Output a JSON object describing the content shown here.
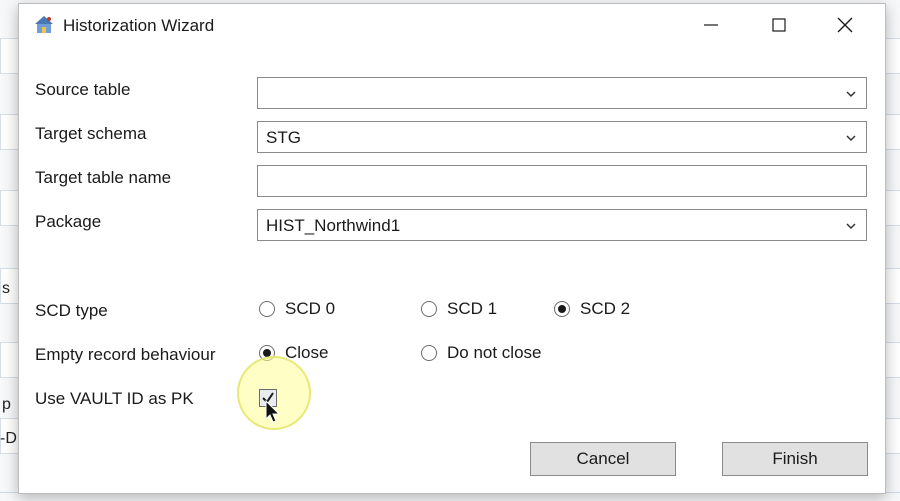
{
  "window": {
    "title": "Historization Wizard",
    "icon": "wizard-icon"
  },
  "form": {
    "source_table_label": "Source table",
    "source_table_value": "",
    "target_schema_label": "Target schema",
    "target_schema_value": "STG",
    "target_table_label": "Target table name",
    "target_table_value": "",
    "package_label": "Package",
    "package_value": "HIST_Northwind1",
    "scd_type_label": "SCD type",
    "scd_options": [
      "SCD 0",
      "SCD 1",
      "SCD 2"
    ],
    "scd_selected": "SCD 2",
    "empty_record_label": "Empty record behaviour",
    "empty_record_options": [
      "Close",
      "Do not close"
    ],
    "empty_record_selected": "Close",
    "vault_id_label": "Use VAULT ID as PK",
    "vault_id_checked": true
  },
  "buttons": {
    "cancel": "Cancel",
    "finish": "Finish"
  },
  "background": {
    "fragments": [
      "s",
      "p",
      "-D"
    ]
  }
}
